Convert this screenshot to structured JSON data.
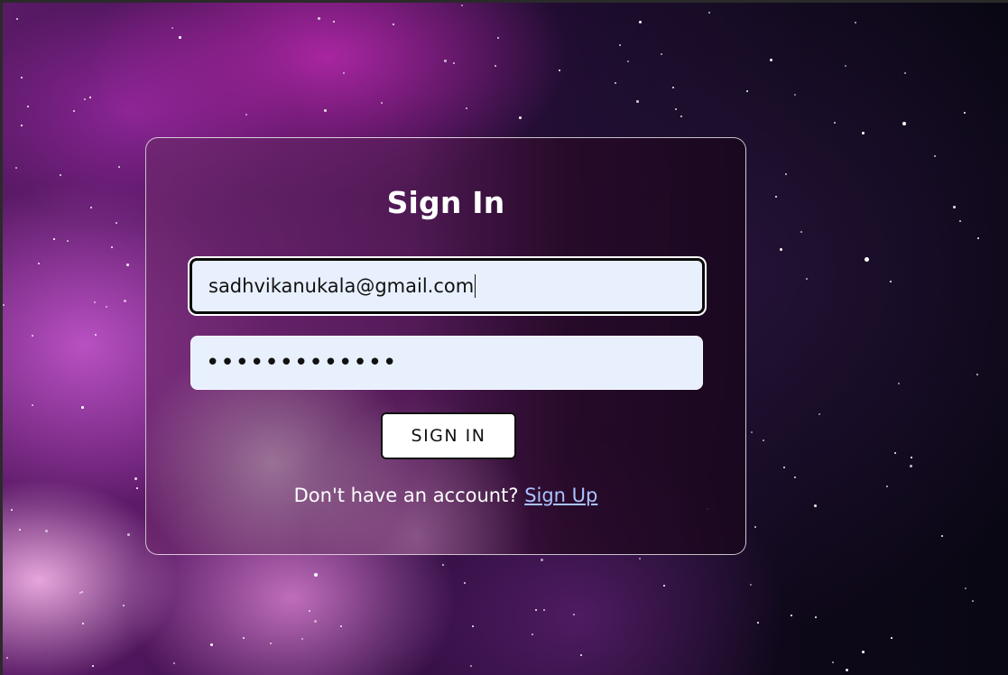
{
  "form": {
    "title": "Sign In",
    "email_value": "sadhvikanukala@gmail.com",
    "password_mask": "•••••••••••••",
    "submit_label": "SIGN IN",
    "footer_text": "Don't have an account? ",
    "signup_link": "Sign Up"
  }
}
